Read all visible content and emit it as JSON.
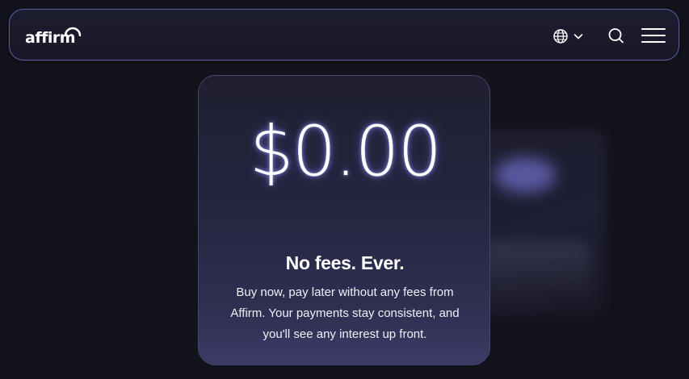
{
  "header": {
    "logo_text": "affirm",
    "icons": {
      "language": "globe-icon",
      "language_dropdown": "chevron-down-icon",
      "search": "search-icon",
      "menu": "hamburger-menu-icon"
    }
  },
  "card": {
    "amount": "$0.00",
    "headline": "No fees. Ever.",
    "body": "Buy now, pay later without any fees from Affirm. Your payments stay consistent, and you'll see any interest up front."
  },
  "colors": {
    "background": "#13131c",
    "nav_border": "#5a5a9e",
    "card_glow": "#6b6bc4"
  }
}
